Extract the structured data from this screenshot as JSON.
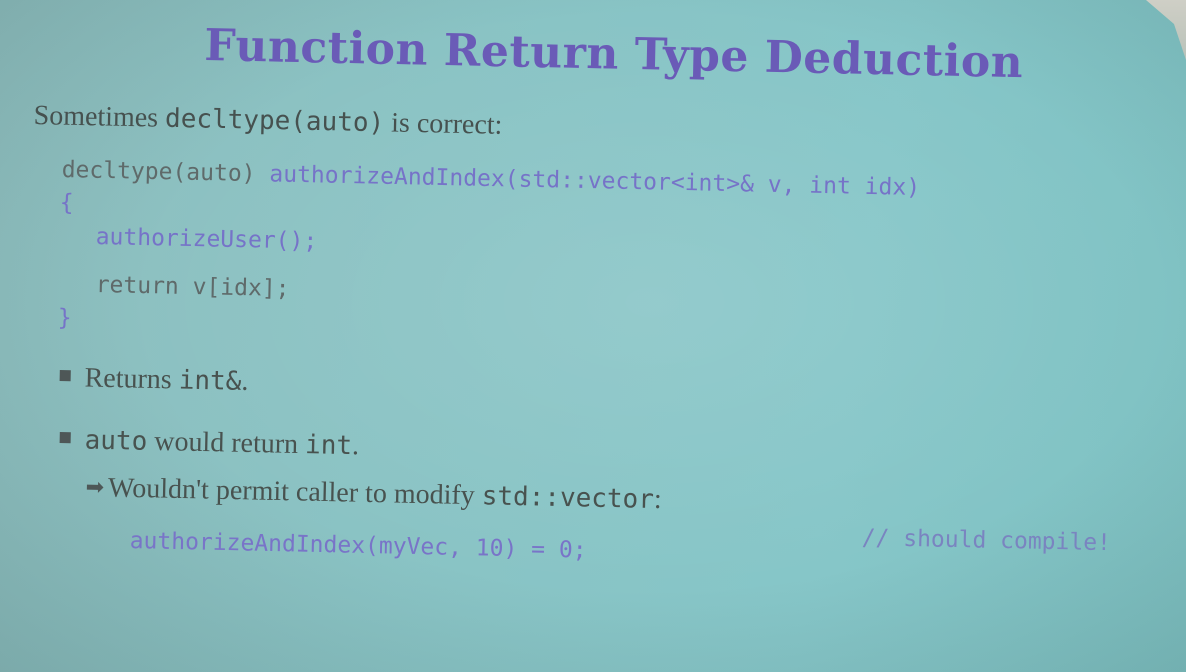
{
  "slide": {
    "title": "Function Return Type Deduction",
    "intro": {
      "prefix": "Sometimes ",
      "code": "decltype(auto)",
      "suffix": " is correct:"
    },
    "code_block": {
      "line1_keyword": "decltype(auto) ",
      "line1_signature": "authorizeAndIndex(std::vector<int>& v, int idx)",
      "open_brace": "{",
      "line2": "authorizeUser();",
      "line3": "return v[idx];",
      "close_brace": "}"
    },
    "bullets": [
      {
        "prefix": "Returns ",
        "code": "int&",
        "suffix": "."
      },
      {
        "code1": "auto",
        "middle": " would return ",
        "code2": "int",
        "suffix": "."
      }
    ],
    "sub_bullet": {
      "prefix": "Wouldn't permit caller to modify ",
      "code": "std::vector",
      "suffix": ":"
    },
    "example": {
      "code": "authorizeAndIndex(myVec, 10) = 0;",
      "comment": "// should compile!"
    }
  },
  "colors": {
    "title": "#6a5bb7",
    "code_highlight": "#7673c8",
    "background": "#86c6c8"
  },
  "icons": {
    "bullet": "square-bullet-icon",
    "sub_bullet": "right-arrow-icon"
  }
}
